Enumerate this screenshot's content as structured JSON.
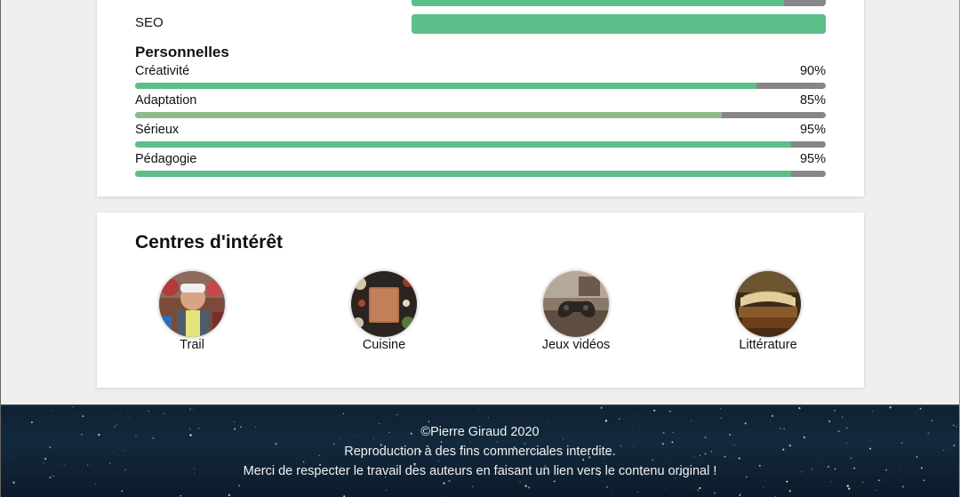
{
  "skills_top": {
    "partial_row": {
      "value_percent": 90
    },
    "seo": {
      "label": "SEO",
      "value_percent": 100
    }
  },
  "personal": {
    "title": "Personnelles",
    "items": [
      {
        "name": "Créativité",
        "percent": "90%",
        "value": 90,
        "color": "#5bbf8a"
      },
      {
        "name": "Adaptation",
        "percent": "85%",
        "value": 85,
        "color": "#8cbc8a"
      },
      {
        "name": "Sérieux",
        "percent": "95%",
        "value": 95,
        "color": "#5bbf8a"
      },
      {
        "name": "Pédagogie",
        "percent": "95%",
        "value": 95,
        "color": "#5bbf8a"
      }
    ]
  },
  "interests": {
    "title": "Centres d'intérêt",
    "items": [
      {
        "label": "Trail",
        "icon": "trail-photo"
      },
      {
        "label": "Cuisine",
        "icon": "cuisine-photo"
      },
      {
        "label": "Jeux vidéos",
        "icon": "gamepad-photo"
      },
      {
        "label": "Littérature",
        "icon": "books-photo"
      }
    ]
  },
  "footer": {
    "copyright": "©Pierre Giraud 2020",
    "line2": "Reproduction à des fins commerciales interdite.",
    "line3": "Merci de respecter le travail des auteurs en faisant un lien vers le contenu original !"
  },
  "colors": {
    "accent": "#5bbf8a",
    "track": "#868686",
    "footer_bg": "#13293d"
  }
}
